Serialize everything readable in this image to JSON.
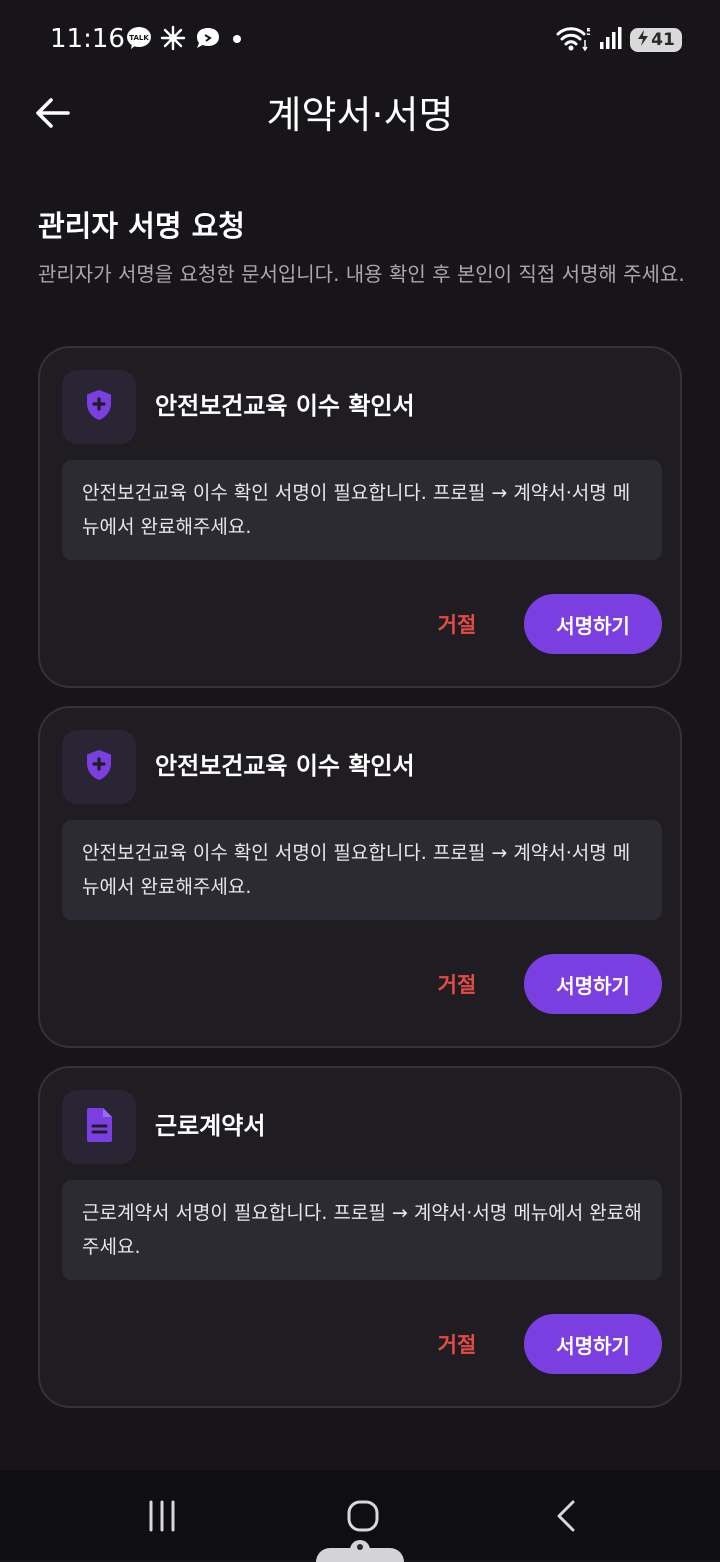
{
  "status_bar": {
    "time": "11:16",
    "battery": "41"
  },
  "header": {
    "title": "계약서·서명"
  },
  "section": {
    "title": "관리자 서명 요청",
    "description": "관리자가 서명을 요청한 문서입니다. 내용 확인 후 본인이 직접 서명해 주세요."
  },
  "cards": [
    {
      "icon": "shield-plus-icon",
      "title": "안전보건교육 이수 확인서",
      "message": "안전보건교육 이수 확인 서명이 필요합니다. 프로필 → 계약서·서명 메뉴에서 완료해주세요.",
      "reject_label": "거절",
      "sign_label": "서명하기"
    },
    {
      "icon": "shield-plus-icon",
      "title": "안전보건교육 이수 확인서",
      "message": "안전보건교육 이수 확인 서명이 필요합니다. 프로필 → 계약서·서명 메뉴에서 완료해주세요.",
      "reject_label": "거절",
      "sign_label": "서명하기"
    },
    {
      "icon": "document-icon",
      "title": "근로계약서",
      "message": "근로계약서 서명이 필요합니다. 프로필 → 계약서·서명 메뉴에서 완료해주세요.",
      "reject_label": "거절",
      "sign_label": "서명하기"
    }
  ],
  "colors": {
    "background": "#171519",
    "card": "#201d22",
    "accent": "#7b3fe1",
    "reject": "#e24c48"
  }
}
